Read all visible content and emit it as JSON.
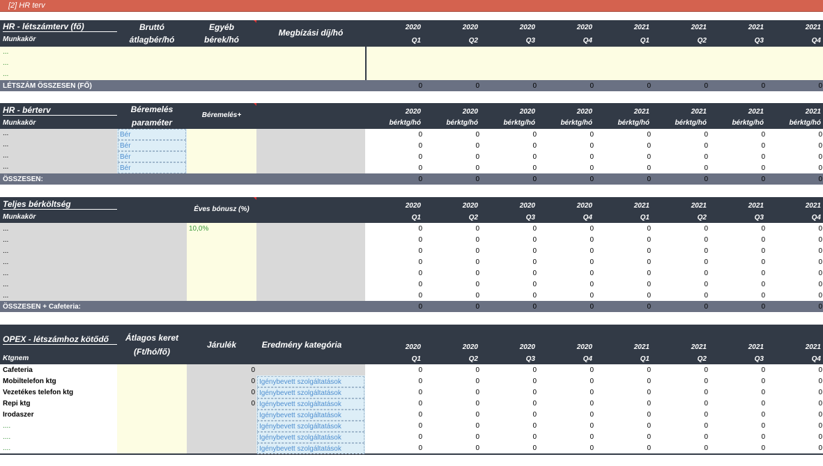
{
  "sheet_title": "[2] HR terv",
  "quarters": [
    {
      "year": "2020",
      "q": "Q1"
    },
    {
      "year": "2020",
      "q": "Q2"
    },
    {
      "year": "2020",
      "q": "Q3"
    },
    {
      "year": "2020",
      "q": "Q4"
    },
    {
      "year": "2021",
      "q": "Q1"
    },
    {
      "year": "2021",
      "q": "Q2"
    },
    {
      "year": "2021",
      "q": "Q3"
    },
    {
      "year": "2021",
      "q": "Q4"
    }
  ],
  "unit_berktg": "bérktg/hó",
  "section1": {
    "title": "HR - létszámterv (fő)",
    "sub": "Munkakör",
    "col_brutto_1": "Bruttó",
    "col_brutto_2": "átlagbér/hó",
    "col_egyeb_1": "Egyéb",
    "col_egyeb_2": "bérek/hó",
    "col_megbizasi": "Megbízási díj/hó",
    "rows": [
      "...",
      "...",
      "..."
    ],
    "total_label": "LÉTSZÁM ÖSSZESEN (FŐ)",
    "total_values": [
      "0",
      "0",
      "0",
      "0",
      "0",
      "0",
      "0",
      "0"
    ]
  },
  "section2": {
    "title": "HR - bérterv",
    "sub": "Munkakör",
    "col_beremeles_1": "Béremelés",
    "col_beremeles_2": "paraméter",
    "col_beremeles_plus": "Béremelés+",
    "rows": [
      {
        "label": "...",
        "param": "Bér",
        "values": [
          "0",
          "0",
          "0",
          "0",
          "0",
          "0",
          "0",
          "0"
        ]
      },
      {
        "label": "...",
        "param": "Bér",
        "values": [
          "0",
          "0",
          "0",
          "0",
          "0",
          "0",
          "0",
          "0"
        ]
      },
      {
        "label": "...",
        "param": "Bér",
        "values": [
          "0",
          "0",
          "0",
          "0",
          "0",
          "0",
          "0",
          "0"
        ]
      },
      {
        "label": "...",
        "param": "Bér",
        "values": [
          "0",
          "0",
          "0",
          "0",
          "0",
          "0",
          "0",
          "0"
        ]
      }
    ],
    "total_label": "ÖSSZESEN:",
    "total_values": [
      "0",
      "0",
      "0",
      "0",
      "0",
      "0",
      "0",
      "0"
    ]
  },
  "section3": {
    "title": "Teljes bérköltség",
    "sub": "Munkakör",
    "col_bonus": "Éves bónusz (%)",
    "bonus_value": "10,0%",
    "rows": [
      {
        "label": "...",
        "values": [
          "0",
          "0",
          "0",
          "0",
          "0",
          "0",
          "0",
          "0"
        ]
      },
      {
        "label": "...",
        "values": [
          "0",
          "0",
          "0",
          "0",
          "0",
          "0",
          "0",
          "0"
        ]
      },
      {
        "label": "...",
        "values": [
          "0",
          "0",
          "0",
          "0",
          "0",
          "0",
          "0",
          "0"
        ]
      },
      {
        "label": "...",
        "values": [
          "0",
          "0",
          "0",
          "0",
          "0",
          "0",
          "0",
          "0"
        ]
      },
      {
        "label": "...",
        "values": [
          "0",
          "0",
          "0",
          "0",
          "0",
          "0",
          "0",
          "0"
        ]
      },
      {
        "label": "...",
        "values": [
          "0",
          "0",
          "0",
          "0",
          "0",
          "0",
          "0",
          "0"
        ]
      },
      {
        "label": "...",
        "values": [
          "0",
          "0",
          "0",
          "0",
          "0",
          "0",
          "0",
          "0"
        ]
      }
    ],
    "total_label": "ÖSSZESEN + Cafeteria:",
    "total_values": [
      "0",
      "0",
      "0",
      "0",
      "0",
      "0",
      "0",
      "0"
    ]
  },
  "section4": {
    "title": "OPEX - létszámhoz kötődő",
    "sub": "Ktgnem",
    "col_keret_1": "Átlagos keret",
    "col_keret_2": "(Ft/hó/fő)",
    "col_jarulek": "Járulék",
    "col_eredmeny": "Eredmény kategória",
    "rows": [
      {
        "label": "Cafeteria",
        "jarulek": "0",
        "kategoria": "",
        "values": [
          "0",
          "0",
          "0",
          "0",
          "0",
          "0",
          "0",
          "0"
        ]
      },
      {
        "label": "Mobiltelefon ktg",
        "jarulek": "0",
        "kategoria": "Igénybevett szolgáltatások",
        "values": [
          "0",
          "0",
          "0",
          "0",
          "0",
          "0",
          "0",
          "0"
        ]
      },
      {
        "label": "Vezetékes telefon ktg",
        "jarulek": "0",
        "kategoria": "Igénybevett szolgáltatások",
        "values": [
          "0",
          "0",
          "0",
          "0",
          "0",
          "0",
          "0",
          "0"
        ]
      },
      {
        "label": "Repi ktg",
        "jarulek": "0",
        "kategoria": "Igénybevett szolgáltatások",
        "values": [
          "0",
          "0",
          "0",
          "0",
          "0",
          "0",
          "0",
          "0"
        ]
      },
      {
        "label": "Irodaszer",
        "jarulek": "",
        "kategoria": "Igénybevett szolgáltatások",
        "values": [
          "0",
          "0",
          "0",
          "0",
          "0",
          "0",
          "0",
          "0"
        ]
      },
      {
        "label": "....",
        "jarulek": "",
        "kategoria": "Igénybevett szolgáltatások",
        "values": [
          "0",
          "0",
          "0",
          "0",
          "0",
          "0",
          "0",
          "0"
        ]
      },
      {
        "label": "....",
        "jarulek": "",
        "kategoria": "Igénybevett szolgáltatások",
        "values": [
          "0",
          "0",
          "0",
          "0",
          "0",
          "0",
          "0",
          "0"
        ]
      },
      {
        "label": "....",
        "jarulek": "",
        "kategoria": "Igénybevett szolgáltatások",
        "values": [
          "0",
          "0",
          "0",
          "0",
          "0",
          "0",
          "0",
          "0"
        ]
      }
    ]
  }
}
